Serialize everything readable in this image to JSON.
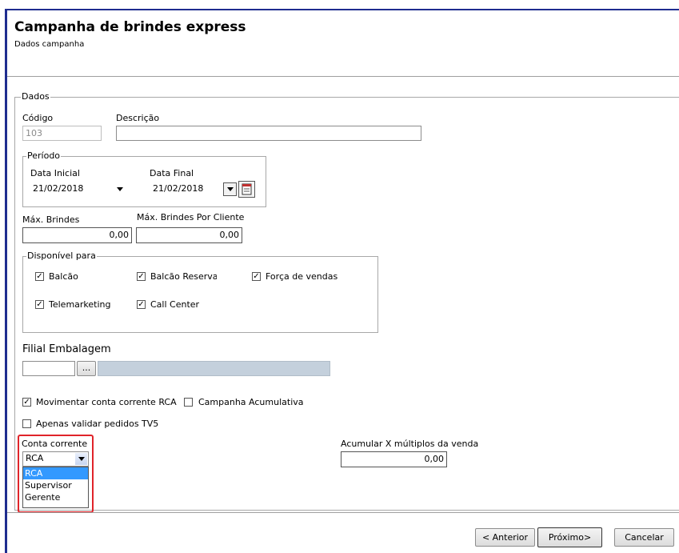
{
  "header": {
    "title": "Campanha de brindes express",
    "subtitle": "Dados campanha"
  },
  "dados": {
    "group_label": "Dados",
    "codigo_label": "Código",
    "codigo_value": "103",
    "descricao_label": "Descrição",
    "descricao_value": ""
  },
  "periodo": {
    "group_label": "Período",
    "data_inicial_label": "Data Inicial",
    "data_inicial_value": "21/02/2018",
    "data_final_label": "Data Final",
    "data_final_value": "21/02/2018"
  },
  "max_brindes": {
    "label": "Máx. Brindes",
    "value": "0,00"
  },
  "max_brindes_cliente": {
    "label": "Máx. Brindes Por Cliente",
    "value": "0,00"
  },
  "disponivel": {
    "group_label": "Disponível para",
    "balcao": {
      "label": "Balcão",
      "checked": true
    },
    "balcao_reserva": {
      "label": "Balcão Reserva",
      "checked": true
    },
    "forca_vendas": {
      "label": "Força de vendas",
      "checked": true
    },
    "telemarketing": {
      "label": "Telemarketing",
      "checked": true
    },
    "call_center": {
      "label": "Call Center",
      "checked": true
    }
  },
  "filial": {
    "label": "Filial Embalagem",
    "code_value": "",
    "lookup_button": "...",
    "description_value": ""
  },
  "options": {
    "movimentar": {
      "label": "Movimentar conta corrente RCA",
      "checked": true
    },
    "acumulativa": {
      "label": "Campanha Acumulativa",
      "checked": false
    },
    "validar_tv5": {
      "label": "Apenas validar pedidos TV5",
      "checked": false
    }
  },
  "conta_corrente": {
    "label": "Conta corrente",
    "selected": "RCA",
    "options": [
      "RCA",
      "Supervisor",
      "Gerente"
    ],
    "highlight_color": "#e0242a",
    "selection_color": "#3399ff"
  },
  "acumular": {
    "label": "Acumular X múltiplos da venda",
    "value": "0,00"
  },
  "buttons": {
    "anterior": "< Anterior",
    "proximo": "Próximo>",
    "cancelar": "Cancelar"
  }
}
